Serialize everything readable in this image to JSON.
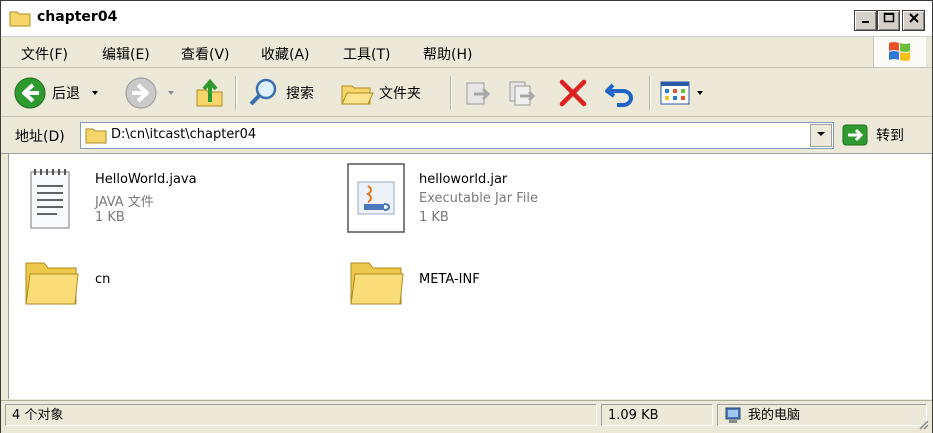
{
  "window": {
    "title": "chapter04"
  },
  "menu": [
    "文件(F)",
    "编辑(E)",
    "查看(V)",
    "收藏(A)",
    "工具(T)",
    "帮助(H)"
  ],
  "toolbar": {
    "back_label": "后退",
    "search_label": "搜索",
    "folders_label": "文件夹"
  },
  "address": {
    "label": "地址(D)",
    "path": "D:\\cn\\itcast\\chapter04",
    "go_label": "转到"
  },
  "files": [
    {
      "name": "HelloWorld.java",
      "type": "JAVA 文件",
      "size": "1 KB",
      "icon": "text-file-icon"
    },
    {
      "name": "helloworld.jar",
      "type": "Executable Jar File",
      "size": "1 KB",
      "icon": "jar-file-icon"
    },
    {
      "name": "cn",
      "icon": "folder-icon"
    },
    {
      "name": "META-INF",
      "icon": "folder-icon"
    }
  ],
  "status": {
    "objects": "4 个对象",
    "size": "1.09 KB",
    "location": "我的电脑"
  },
  "colors": {
    "folder": "#f6d56a",
    "back_green": "#2f9a2f",
    "delete_red": "#e02020",
    "undo_blue": "#1e64c8"
  }
}
